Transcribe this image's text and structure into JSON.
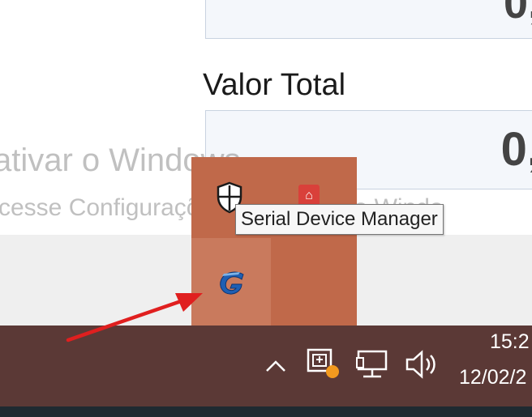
{
  "app": {
    "top_field_value": "0,",
    "total_label": "Valor Total",
    "total_value": "0,"
  },
  "watermark": {
    "line1": "ativar o Windows",
    "line2": "cesse Configurações para ativar o Windo"
  },
  "tray_overflow": {
    "icons": [
      "shield-icon",
      "red-app-icon",
      "serial-device-manager-icon"
    ],
    "tooltip": "Serial Device Manager"
  },
  "taskbar": {
    "time": "15:2",
    "date": "12/02/2",
    "icons": [
      "chevron-up-icon",
      "notification-app-icon",
      "network-icon",
      "volume-icon"
    ],
    "badge_color": "#f39a1f"
  },
  "annotation": {
    "arrow_color": "#e01f1f"
  }
}
